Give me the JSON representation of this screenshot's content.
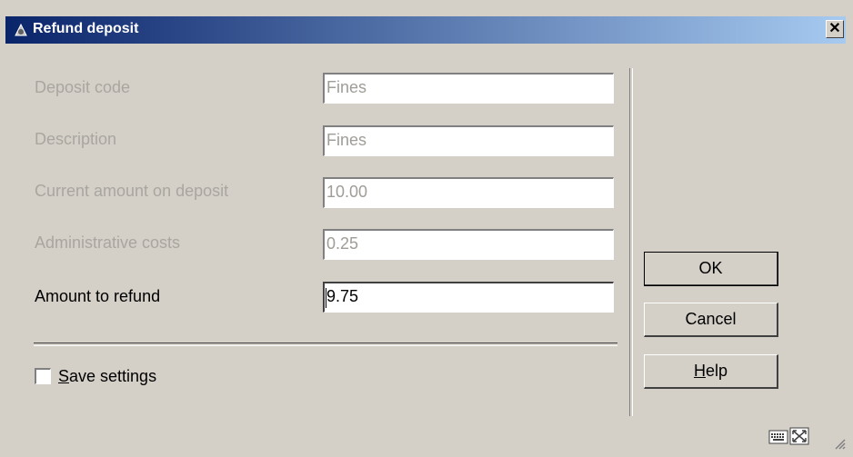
{
  "window": {
    "title": "Refund deposit",
    "app_icon": "app-logo-icon",
    "close_icon": "close-icon"
  },
  "form": {
    "fields": [
      {
        "label": "Deposit code",
        "value": "Fines",
        "enabled": false
      },
      {
        "label": "Description",
        "value": "Fines",
        "enabled": false
      },
      {
        "label": "Current amount on deposit",
        "value": "10.00",
        "enabled": false
      },
      {
        "label": "Administrative costs",
        "value": "0.25",
        "enabled": false
      },
      {
        "label": "Amount to refund",
        "value": "9.75",
        "enabled": true
      }
    ],
    "save_settings": {
      "label_first": "S",
      "label_rest": "ave settings",
      "checked": false
    }
  },
  "buttons": {
    "ok": "OK",
    "cancel": "Cancel",
    "help_first": "H",
    "help_rest": "elp"
  },
  "status_bar": {
    "icons": [
      "keyboard-icon",
      "resize-frame-icon"
    ]
  },
  "colors": {
    "titlebar_start": "#0a246a",
    "titlebar_end": "#a6caf0",
    "dialog_bg": "#d4d0c8",
    "disabled_text": "#a9a6a0"
  }
}
